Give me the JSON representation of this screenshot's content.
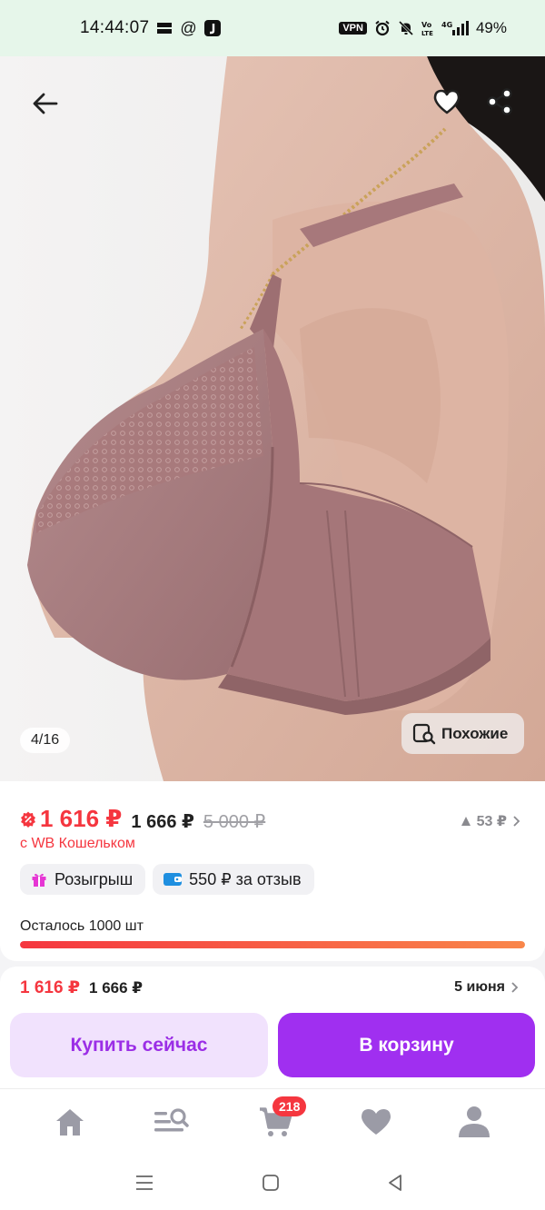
{
  "status_bar": {
    "time": "14:44:07",
    "left_icons": [
      "mow-life-icon",
      "at-icon",
      "j-app-icon"
    ],
    "vpn": "VPN",
    "battery": "49%"
  },
  "gallery": {
    "counter": "4/16",
    "similar_label": "Похожие"
  },
  "price": {
    "current": "1 616 ₽",
    "without_wallet": "1 666 ₽",
    "old": "5 000 ₽",
    "delta": "53 ₽",
    "wallet_note": "с WB Кошельком"
  },
  "chips": [
    {
      "icon": "gift-icon",
      "label": "Розыгрыш"
    },
    {
      "icon": "wallet-icon",
      "label": "550 ₽ за отзыв"
    }
  ],
  "stock": {
    "label": "Осталось 1000 шт",
    "level": 1.0
  },
  "purchase": {
    "price": "1 616 ₽",
    "price_alt": "1 666 ₽",
    "delivery": "5 июня",
    "buy_now_label": "Купить сейчас",
    "add_to_cart_label": "В корзину"
  },
  "bottom_nav": {
    "items": [
      "home-icon",
      "catalog-search-icon",
      "cart-icon",
      "favorites-icon",
      "profile-icon"
    ],
    "cart_badge": "218"
  },
  "colors": {
    "accent": "#a02ff0",
    "accent_light": "#f1e2fd",
    "price_red": "#f5363f",
    "status_bar_bg": "#e6f6ea",
    "product_color": "#a77a7c"
  }
}
